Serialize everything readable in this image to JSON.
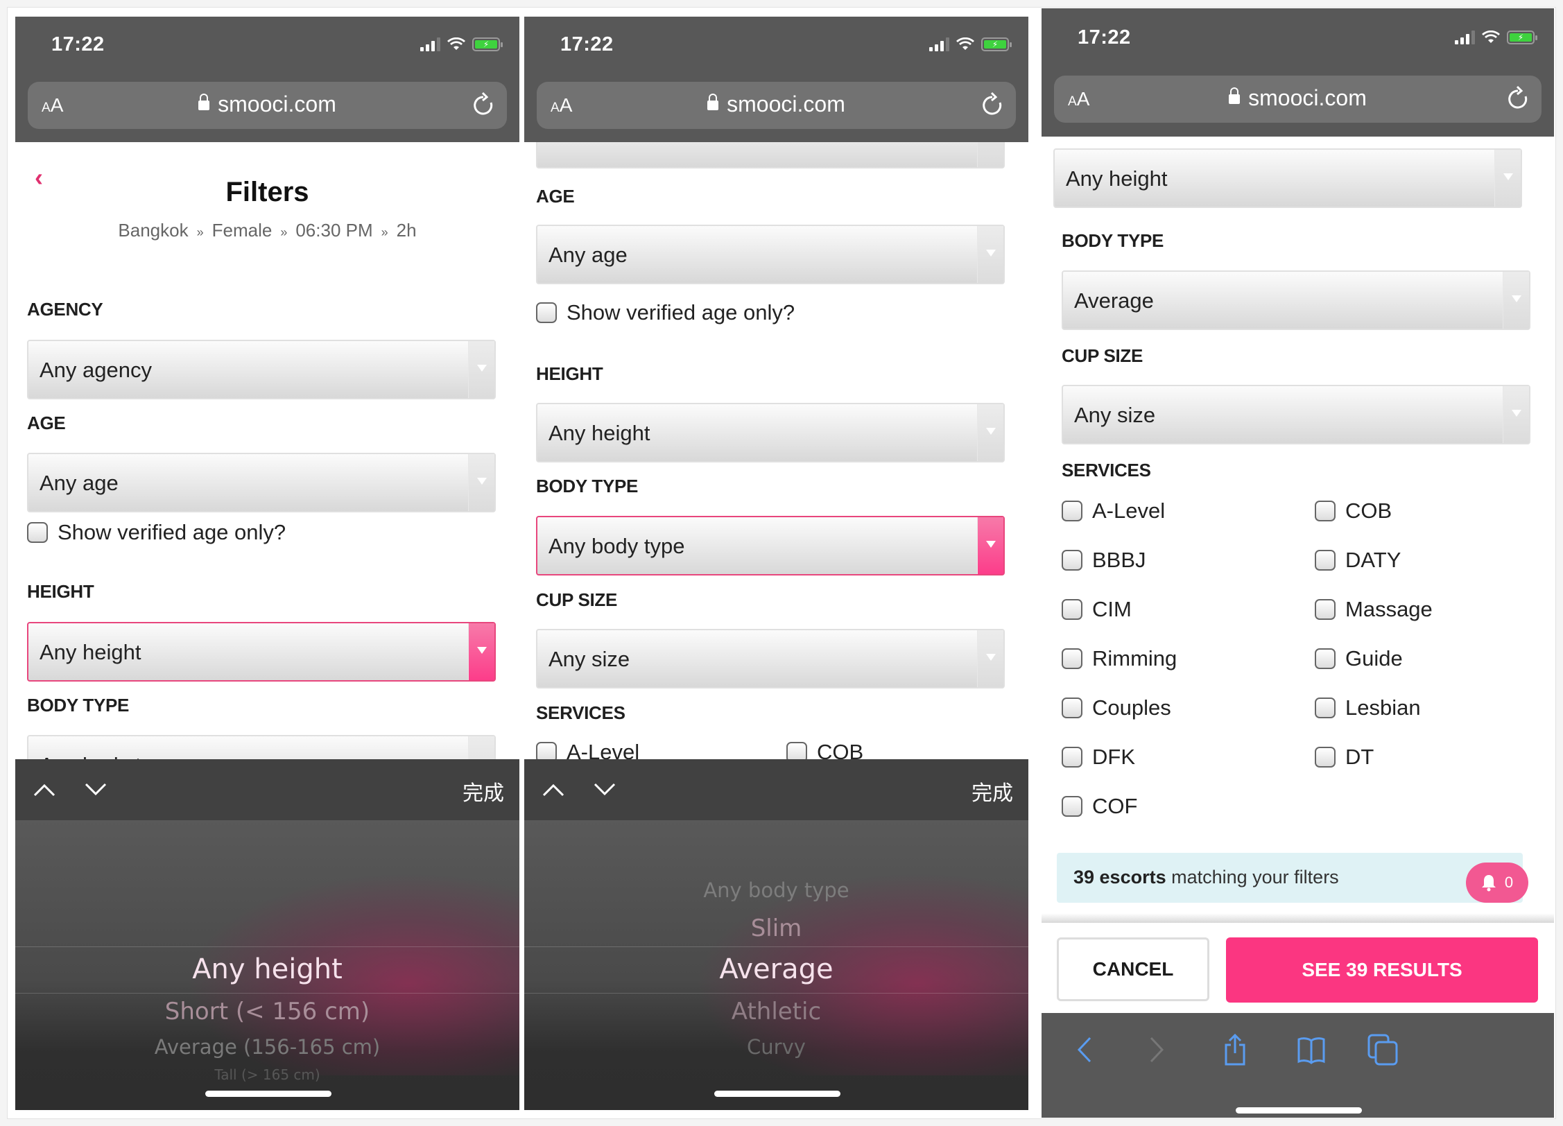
{
  "status": {
    "time": "17:22"
  },
  "browser": {
    "text_size_label": "AA",
    "url": "smooci.com"
  },
  "header": {
    "title": "Filters",
    "breadcrumb": [
      "Bangkok",
      "Female",
      "06:30 PM",
      "2h"
    ],
    "breadcrumb_sep": "»"
  },
  "filters": {
    "agency": {
      "label": "AGENCY",
      "value": "Any agency"
    },
    "age": {
      "label": "AGE",
      "value": "Any age"
    },
    "verified_age": {
      "label": "Show verified age only?",
      "checked": false
    },
    "height": {
      "label": "HEIGHT",
      "value": "Any height"
    },
    "body_type": {
      "label": "BODY TYPE",
      "value": "Any body type",
      "value_after": "Average"
    },
    "cup_size": {
      "label": "CUP SIZE",
      "value": "Any size"
    },
    "services": {
      "label": "SERVICES",
      "items": [
        "A-Level",
        "COB",
        "BBBJ",
        "DATY",
        "CIM",
        "Massage",
        "Rimming",
        "Guide",
        "Couples",
        "Lesbian",
        "DFK",
        "DT",
        "COF"
      ]
    }
  },
  "keyboard_bar": {
    "done_label": "完成"
  },
  "height_picker": {
    "options": [
      "Any height",
      "Short (< 156 cm)",
      "Average (156-165 cm)",
      "Tall (> 165 cm)"
    ],
    "selected": "Any height"
  },
  "body_picker": {
    "options": [
      "Any body type",
      "Slim",
      "Average",
      "Athletic",
      "Curvy"
    ],
    "selected": "Average"
  },
  "results": {
    "count_text": "39 escorts",
    "suffix": " matching your filters",
    "alert_count": "0",
    "cancel_label": "CANCEL",
    "see_label": "SEE 39 RESULTS"
  },
  "colors": {
    "accent": "#fb3681",
    "dark_chrome": "#585858",
    "alert_bg": "#dff2f5",
    "ios_blue": "#5a9cf0"
  }
}
